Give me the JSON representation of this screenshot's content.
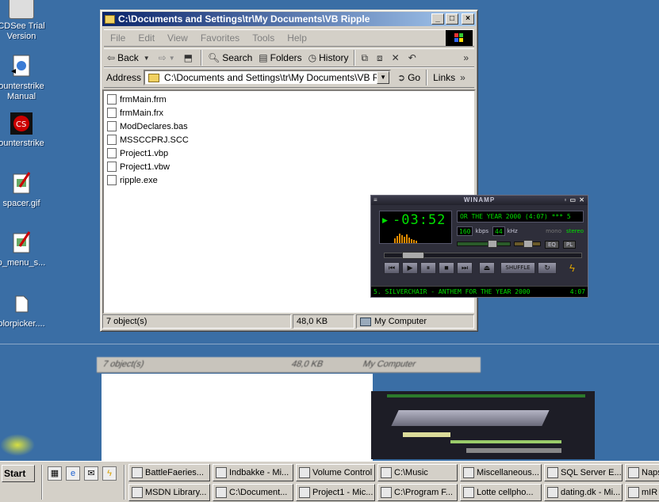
{
  "desktop": {
    "icons": [
      {
        "label": "CDSee Trial",
        "label2": "Version",
        "icon": "acdsee-icon"
      },
      {
        "label": "ounterstrike",
        "label2": "Manual",
        "icon": "document-icon"
      },
      {
        "label": "ounterstrike",
        "label2": "",
        "icon": "counterstrike-icon"
      },
      {
        "label": "spacer.gif",
        "label2": "",
        "icon": "image-file-icon"
      },
      {
        "label": "o_menu_s...",
        "label2": "",
        "icon": "image-file-icon"
      },
      {
        "label": "olorpicker....",
        "label2": "",
        "icon": "file-icon"
      }
    ]
  },
  "explorer": {
    "title": "C:\\Documents and Settings\\tr\\My Documents\\VB Ripple",
    "menu": [
      "File",
      "Edit",
      "View",
      "Favorites",
      "Tools",
      "Help"
    ],
    "toolbar": {
      "back": "Back",
      "search": "Search",
      "folders": "Folders",
      "history": "History"
    },
    "address_label": "Address",
    "address": "C:\\Documents and Settings\\tr\\My Documents\\VB Ripple",
    "go": "Go",
    "links": "Links",
    "files": [
      "frmMain.frm",
      "frmMain.frx",
      "ModDeclares.bas",
      "MSSCCPRJ.SCC",
      "Project1.vbp",
      "Project1.vbw",
      "ripple.exe"
    ],
    "status": {
      "objects": "7 object(s)",
      "size": "48,0 KB",
      "location": "My Computer"
    }
  },
  "winamp": {
    "title": "WINAMP",
    "time": "-03:52",
    "marquee": "OR THE YEAR 2000 (4:07)  ***  5",
    "kbps": "160",
    "kbps_label": "kbps",
    "khz": "44",
    "khz_label": "kHz",
    "mono": "mono",
    "stereo": "stereo",
    "eq": "EQ",
    "pl": "PL",
    "shuffle": "SHUFFLE",
    "playlist_line": "5. SILVERCHAIR - ANTHEM FOR THE YEAR 2000",
    "playlist_time": "4:07",
    "seek_progress": 0.1,
    "volume": 0.7
  },
  "glitch": {
    "status_objects": "7 object(s)",
    "status_size": "48,0 KB",
    "status_location": "My Computer"
  },
  "taskbar": {
    "start": "Start",
    "quicklaunch": [
      "show-desktop-icon",
      "internet-explorer-icon",
      "outlook-icon",
      "winamp-icon"
    ],
    "row1": [
      "BattleFaeries...",
      "Indbakke - Mi...",
      "Volume Control",
      "C:\\Music",
      "Miscellaneous...",
      "SQL Server E...",
      "Naps"
    ],
    "row2": [
      "MSDN Library...",
      "C:\\Document...",
      "Project1 - Mic...",
      "C:\\Program F...",
      "Lotte cellpho...",
      "dating.dk - Mi...",
      "mIR"
    ]
  }
}
